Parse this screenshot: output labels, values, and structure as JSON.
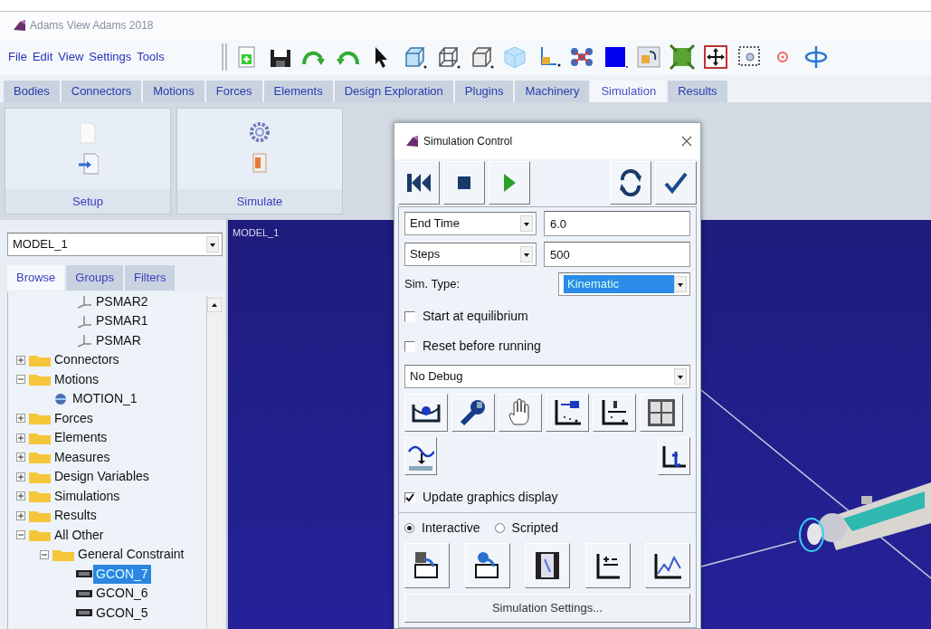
{
  "window": {
    "title": "Adams View Adams 2018"
  },
  "menu": [
    "File",
    "Edit",
    "View",
    "Settings",
    "Tools"
  ],
  "tabs": [
    {
      "label": "Bodies",
      "selected": false
    },
    {
      "label": "Connectors",
      "selected": false
    },
    {
      "label": "Motions",
      "selected": false
    },
    {
      "label": "Forces",
      "selected": false
    },
    {
      "label": "Elements",
      "selected": false
    },
    {
      "label": "Design Exploration",
      "selected": false
    },
    {
      "label": "Plugins",
      "selected": false
    },
    {
      "label": "Machinery",
      "selected": false
    },
    {
      "label": "Simulation",
      "selected": true
    },
    {
      "label": "Results",
      "selected": false
    }
  ],
  "ribbon": {
    "groups": [
      {
        "label": "Setup"
      },
      {
        "label": "Simulate"
      }
    ]
  },
  "browser": {
    "model": "MODEL_1",
    "tabs": [
      {
        "label": "Browse",
        "selected": true
      },
      {
        "label": "Groups",
        "selected": false
      },
      {
        "label": "Filters",
        "selected": false
      }
    ],
    "tree": [
      {
        "children": [
          {
            "children": [
              {
                "label": "PSMAR2",
                "kind": "marker",
                "selected": false
              },
              {
                "label": "PSMAR1",
                "kind": "marker",
                "selected": false
              },
              {
                "label": "PSMAR",
                "kind": "marker",
                "selected": false
              }
            ]
          }
        ]
      },
      {
        "label": "Connectors",
        "kind": "folder",
        "expanded": false,
        "selected": false
      },
      {
        "label": "Motions",
        "kind": "folder",
        "expanded": true,
        "selected": false,
        "children": [
          {
            "label": "MOTION_1",
            "kind": "motion",
            "selected": false
          }
        ]
      },
      {
        "label": "Forces",
        "kind": "folder",
        "expanded": false,
        "selected": false
      },
      {
        "label": "Elements",
        "kind": "folder",
        "expanded": false,
        "selected": false
      },
      {
        "label": "Measures",
        "kind": "folder",
        "expanded": false,
        "selected": false
      },
      {
        "label": "Design Variables",
        "kind": "folder",
        "expanded": false,
        "selected": false
      },
      {
        "label": "Simulations",
        "kind": "folder",
        "expanded": false,
        "selected": false
      },
      {
        "label": "Results",
        "kind": "folder",
        "expanded": false,
        "selected": false
      },
      {
        "label": "All Other",
        "kind": "folder",
        "expanded": true,
        "selected": false,
        "children": [
          {
            "label": "General Constraint",
            "kind": "folder",
            "expanded": true,
            "selected": false,
            "children": [
              {
                "label": "GCON_7",
                "kind": "gcon",
                "selected": true
              },
              {
                "label": "GCON_6",
                "kind": "gcon",
                "selected": false
              },
              {
                "label": "GCON_5",
                "kind": "gcon",
                "selected": false
              }
            ]
          }
        ]
      }
    ]
  },
  "viewport": {
    "label": "MODEL_1"
  },
  "dialog": {
    "title": "Simulation Control",
    "end_mode": "End Time",
    "end_value": "6.0",
    "step_mode": "Steps",
    "step_value": "500",
    "sim_type_label": "Sim. Type:",
    "sim_type": "Kinematic",
    "sim_type_highlighted": true,
    "checks": [
      {
        "label": "Start at equilibrium",
        "checked": false
      },
      {
        "label": "Reset before running",
        "checked": false
      }
    ],
    "debug": "No Debug",
    "update_graphics": {
      "label": "Update graphics display",
      "checked": true
    },
    "modes": [
      {
        "label": "Interactive",
        "selected": true
      },
      {
        "label": "Scripted",
        "selected": false
      }
    ],
    "settings_button": "Simulation Settings..."
  }
}
